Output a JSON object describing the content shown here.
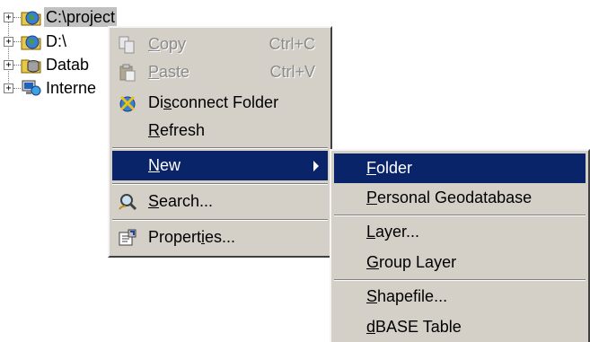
{
  "tree": {
    "items": [
      {
        "label": "C:\\project",
        "expander": "+",
        "icon": "connected-folder-icon",
        "selected": true
      },
      {
        "label": "D:\\",
        "expander": "+",
        "icon": "connected-folder-icon"
      },
      {
        "label": "Datab",
        "expander": "+",
        "icon": "database-connections-icon"
      },
      {
        "label": "Interne",
        "expander": "+",
        "icon": "internet-server-icon"
      }
    ]
  },
  "context_menu": {
    "items": [
      {
        "pre": "",
        "mn": "C",
        "post": "opy",
        "shortcut": "Ctrl+C",
        "icon": "copy-icon",
        "disabled": true
      },
      {
        "pre": "",
        "mn": "P",
        "post": "aste",
        "shortcut": "Ctrl+V",
        "icon": "paste-icon",
        "disabled": true
      },
      {
        "pre": "Di",
        "mn": "s",
        "post": "connect Folder",
        "icon": "disconnect-folder-icon"
      },
      {
        "pre": "",
        "mn": "R",
        "post": "efresh"
      },
      {
        "pre": "",
        "mn": "N",
        "post": "ew",
        "highlighted": true,
        "has_submenu": true
      },
      {
        "pre": "",
        "mn": "S",
        "post": "earch...",
        "icon": "search-icon"
      },
      {
        "pre": "Propert",
        "mn": "i",
        "post": "es...",
        "icon": "properties-icon"
      }
    ]
  },
  "submenu": {
    "items": [
      {
        "pre": "",
        "mn": "F",
        "post": "older",
        "highlighted": true
      },
      {
        "pre": "",
        "mn": "P",
        "post": "ersonal Geodatabase"
      },
      {
        "pre": "",
        "mn": "L",
        "post": "ayer..."
      },
      {
        "pre": "",
        "mn": "G",
        "post": "roup Layer"
      },
      {
        "pre": "",
        "mn": "S",
        "post": "hapefile..."
      },
      {
        "pre": "",
        "mn": "d",
        "post": "BASE Table"
      }
    ]
  },
  "colors": {
    "menu_bg": "#d4d0c8",
    "highlight": "#0a246a",
    "selection": "#c0c0c0"
  }
}
